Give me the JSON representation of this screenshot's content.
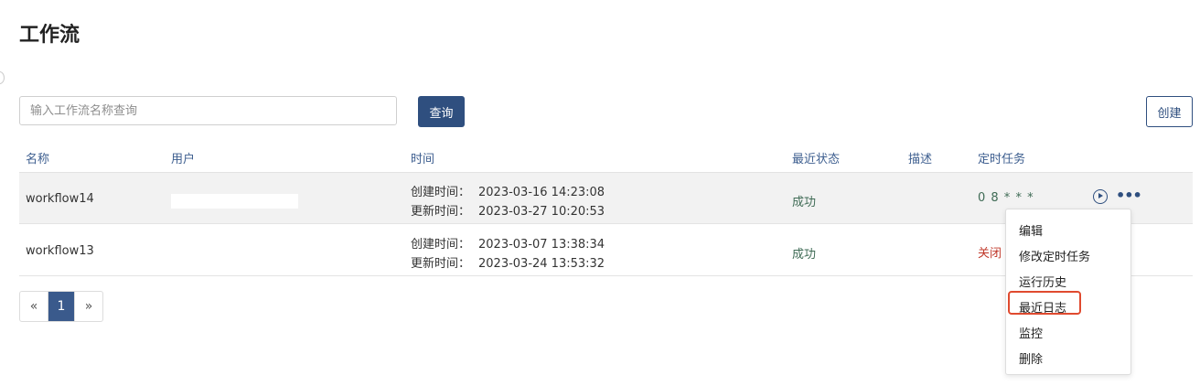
{
  "page": {
    "title": "工作流"
  },
  "search": {
    "placeholder": "输入工作流名称查询",
    "query_label": "查询",
    "create_label": "创建"
  },
  "table": {
    "columns": [
      "名称",
      "用户",
      "时间",
      "最近状态",
      "描述",
      "定时任务"
    ],
    "created_label": "创建时间：",
    "updated_label": "更新时间：",
    "rows": [
      {
        "name": "workflow14",
        "user": "",
        "created": "2023-03-16 14:23:08",
        "updated": "2023-03-27 10:20:53",
        "status": "成功",
        "description": "",
        "schedule": "0 8 * * *"
      },
      {
        "name": "workflow13",
        "user": "",
        "created": "2023-03-07 13:38:34",
        "updated": "2023-03-24 13:53:32",
        "status": "成功",
        "description": "",
        "schedule": "关闭"
      }
    ]
  },
  "pagination": {
    "prev": "«",
    "current": "1",
    "next": "»"
  },
  "context_menu": {
    "items": [
      "编辑",
      "修改定时任务",
      "运行历史",
      "最近日志",
      "监控",
      "删除"
    ],
    "highlighted": "最近日志"
  },
  "colors": {
    "primary": "#2f4f7f",
    "success": "#3f6b55",
    "closed": "#c0392b",
    "highlight": "#e04a2f"
  }
}
